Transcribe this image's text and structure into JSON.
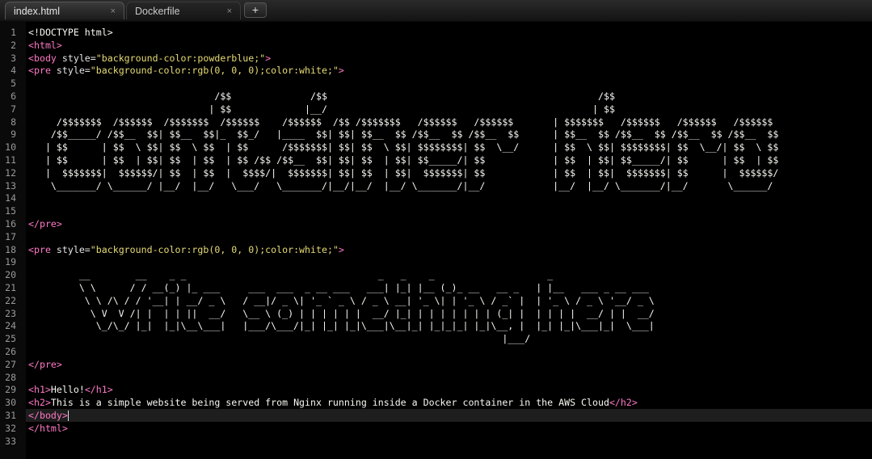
{
  "tabs": [
    {
      "label": "index.html",
      "close": "×",
      "active": true
    },
    {
      "label": "Dockerfile",
      "close": "×",
      "active": false
    }
  ],
  "new_tab": "+",
  "lines": [
    {
      "n": "1",
      "parts": [
        {
          "c": "t",
          "s": "<!DOCTYPE html>"
        }
      ]
    },
    {
      "n": "2",
      "parts": [
        {
          "c": "tagc",
          "s": "<html>"
        }
      ]
    },
    {
      "n": "3",
      "parts": [
        {
          "c": "tagc",
          "s": "<body "
        },
        {
          "c": "attr",
          "s": "style="
        },
        {
          "c": "str",
          "s": "\"background-color:powderblue;\""
        },
        {
          "c": "tagc",
          "s": ">"
        }
      ]
    },
    {
      "n": "4",
      "parts": [
        {
          "c": "tagc",
          "s": "<pre "
        },
        {
          "c": "attr",
          "s": "style="
        },
        {
          "c": "str",
          "s": "\"background-color:rgb(0, 0, 0);color:white;\""
        },
        {
          "c": "tagc",
          "s": ">"
        }
      ]
    },
    {
      "n": "5",
      "parts": [
        {
          "c": "t",
          "s": ""
        }
      ]
    },
    {
      "n": "6",
      "parts": [
        {
          "c": "t",
          "s": "                                 /$$              /$$                                                /$$"
        }
      ]
    },
    {
      "n": "7",
      "parts": [
        {
          "c": "t",
          "s": "                                | $$             |__/                                               | $$"
        }
      ]
    },
    {
      "n": "8",
      "parts": [
        {
          "c": "t",
          "s": "     /$$$$$$$  /$$$$$$  /$$$$$$$  /$$$$$$    /$$$$$$  /$$ /$$$$$$$   /$$$$$$   /$$$$$$       | $$$$$$$   /$$$$$$   /$$$$$$   /$$$$$$"
        }
      ]
    },
    {
      "n": "9",
      "parts": [
        {
          "c": "t",
          "s": "    /$$_____/ /$$__  $$| $$__  $$|_  $$_/   |____  $$| $$| $$__  $$ /$$__  $$ /$$__  $$      | $$__  $$ /$$__  $$ /$$__  $$ /$$__  $$"
        }
      ]
    },
    {
      "n": "10",
      "parts": [
        {
          "c": "t",
          "s": "   | $$      | $$  \\ $$| $$  \\ $$  | $$      /$$$$$$$| $$| $$  \\ $$| $$$$$$$$| $$  \\__/      | $$  \\ $$| $$$$$$$$| $$  \\__/| $$  \\ $$"
        }
      ]
    },
    {
      "n": "11",
      "parts": [
        {
          "c": "t",
          "s": "   | $$      | $$  | $$| $$  | $$  | $$ /$$ /$$__  $$| $$| $$  | $$| $$_____/| $$            | $$  | $$| $$_____/| $$      | $$  | $$"
        }
      ]
    },
    {
      "n": "12",
      "parts": [
        {
          "c": "t",
          "s": "   |  $$$$$$$|  $$$$$$/| $$  | $$  |  $$$$/|  $$$$$$$| $$| $$  | $$|  $$$$$$$| $$            | $$  | $$|  $$$$$$$| $$      |  $$$$$$/"
        }
      ]
    },
    {
      "n": "13",
      "parts": [
        {
          "c": "t",
          "s": "    \\_______/ \\______/ |__/  |__/   \\___/   \\_______/|__/|__/  |__/ \\_______/|__/            |__/  |__/ \\_______/|__/       \\______/"
        }
      ]
    },
    {
      "n": "14",
      "parts": [
        {
          "c": "t",
          "s": ""
        }
      ]
    },
    {
      "n": "15",
      "parts": [
        {
          "c": "t",
          "s": ""
        }
      ]
    },
    {
      "n": "16",
      "parts": [
        {
          "c": "tagc",
          "s": "</pre>"
        }
      ]
    },
    {
      "n": "17",
      "parts": [
        {
          "c": "t",
          "s": ""
        }
      ]
    },
    {
      "n": "18",
      "parts": [
        {
          "c": "tagc",
          "s": "<pre "
        },
        {
          "c": "attr",
          "s": "style="
        },
        {
          "c": "str",
          "s": "\"background-color:rgb(0, 0, 0);color:white;\""
        },
        {
          "c": "tagc",
          "s": ">"
        }
      ]
    },
    {
      "n": "19",
      "parts": [
        {
          "c": "t",
          "s": ""
        }
      ]
    },
    {
      "n": "20",
      "parts": [
        {
          "c": "t",
          "s": "         __        __    _ _                                  _   _    _                    _"
        }
      ]
    },
    {
      "n": "21",
      "parts": [
        {
          "c": "t",
          "s": "         \\ \\      / / __(_) |_ ___     ___  ___  _ __ ___   ___| |_| |__ (_)_ __   __ _   | |__   ___ _ __ ___"
        }
      ]
    },
    {
      "n": "22",
      "parts": [
        {
          "c": "t",
          "s": "          \\ \\ /\\ / / '__| | __/ _ \\   / __|/ _ \\| '_ ` _ \\ / _ \\ __| '_ \\| | '_ \\ / _` |  | '_ \\ / _ \\ '__/ _ \\"
        }
      ]
    },
    {
      "n": "23",
      "parts": [
        {
          "c": "t",
          "s": "           \\ V  V /| |  | | ||  __/   \\__ \\ (_) | | | | | |  __/ |_| | | | | | | | (_| |  | | | |  __/ | |  __/"
        }
      ]
    },
    {
      "n": "24",
      "parts": [
        {
          "c": "t",
          "s": "            \\_/\\_/ |_|  |_|\\__\\___|   |___/\\___/|_| |_| |_|\\___|\\__|_| |_|_|_| |_|\\__, |  |_| |_|\\___|_|  \\___|"
        }
      ]
    },
    {
      "n": "25",
      "parts": [
        {
          "c": "t",
          "s": "                                                                                    |___/"
        }
      ]
    },
    {
      "n": "26",
      "parts": [
        {
          "c": "t",
          "s": ""
        }
      ]
    },
    {
      "n": "27",
      "parts": [
        {
          "c": "tagc",
          "s": "</pre>"
        }
      ]
    },
    {
      "n": "28",
      "parts": [
        {
          "c": "t",
          "s": ""
        }
      ]
    },
    {
      "n": "29",
      "parts": [
        {
          "c": "tagc",
          "s": "<h1>"
        },
        {
          "c": "t",
          "s": "Hello!"
        },
        {
          "c": "tagc",
          "s": "</h1>"
        }
      ]
    },
    {
      "n": "30",
      "parts": [
        {
          "c": "tagc",
          "s": "<h2>"
        },
        {
          "c": "t",
          "s": "This is a simple website being served from Nginx running inside a Docker container in the AWS Cloud"
        },
        {
          "c": "tagc",
          "s": "</h2>"
        }
      ]
    },
    {
      "n": "31",
      "parts": [
        {
          "c": "tagc",
          "s": "</body>"
        }
      ],
      "current": true
    },
    {
      "n": "32",
      "parts": [
        {
          "c": "tagc",
          "s": "</html>"
        }
      ]
    },
    {
      "n": "33",
      "parts": [
        {
          "c": "t",
          "s": ""
        }
      ]
    }
  ]
}
